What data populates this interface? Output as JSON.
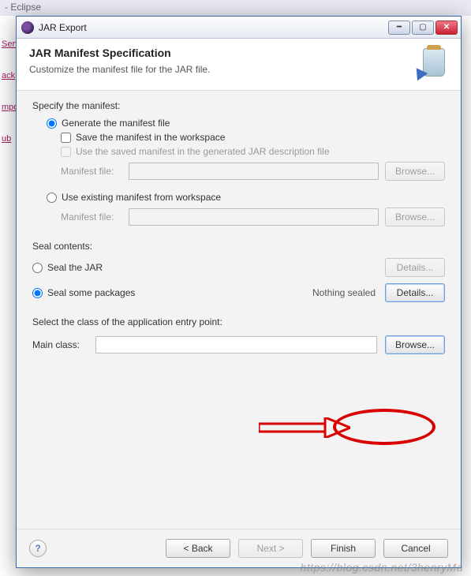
{
  "eclipse": {
    "title_fragment": "- Eclipse",
    "side_items": [
      "Serv",
      "ack",
      "mpo",
      "ub"
    ]
  },
  "dialog": {
    "title": "JAR Export",
    "header_title": "JAR Manifest Specification",
    "header_desc": "Customize the manifest file for the JAR file."
  },
  "manifest": {
    "section_label": "Specify the manifest:",
    "opt_generate": "Generate the manifest file",
    "chk_save": "Save the manifest in the workspace",
    "chk_use_saved": "Use the saved manifest in the generated JAR description file",
    "manifest_file_label": "Manifest file:",
    "manifest_file_value": "",
    "manifest_file_value2": "",
    "opt_existing": "Use existing manifest from workspace",
    "browse_label": "Browse..."
  },
  "seal": {
    "section_label": "Seal contents:",
    "opt_seal_jar": "Seal the JAR",
    "opt_seal_pkgs": "Seal some packages",
    "status": "Nothing sealed",
    "details_label": "Details..."
  },
  "entry": {
    "section_label": "Select the class of the application entry point:",
    "main_class_label": "Main class:",
    "main_class_value": "",
    "browse_label": "Browse..."
  },
  "footer": {
    "back": "< Back",
    "next": "Next >",
    "finish": "Finish",
    "cancel": "Cancel"
  },
  "watermark": "https://blog.csdn.net/3henryMa"
}
